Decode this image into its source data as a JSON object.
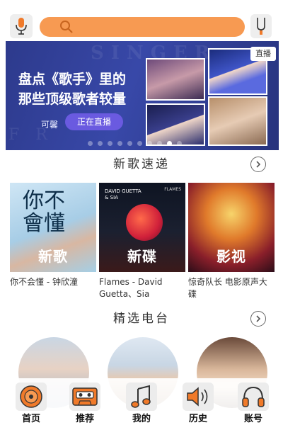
{
  "header": {
    "mic_icon": "microphone-icon",
    "search_icon": "search-icon",
    "tuner_icon": "tuning-fork-icon",
    "search_color": "#f79a52"
  },
  "banner": {
    "headline_line1": "盘点《歌手》里的",
    "headline_line2": "那些顶级歌者较量",
    "host": "可馨",
    "live_button": "正在直播",
    "live_tag": "直播",
    "bg_text": "SINGER",
    "bg_text2": "F R",
    "slide_count": 10,
    "active_slide": 8
  },
  "section_new_songs": {
    "title": "新歌速递",
    "albums": [
      {
        "tag": "新歌",
        "cover_text": "你不\n會懂",
        "caption": "你不会懂 - 钟欣潼"
      },
      {
        "tag": "新碟",
        "cover_brand": "DAVID GUETTA\n& SIA",
        "cover_brand2": "FLAMES",
        "caption": "Flames - David Guetta、Sia"
      },
      {
        "tag": "影视",
        "caption": "惊奇队长 电影原声大碟"
      }
    ]
  },
  "section_radio": {
    "title": "精选电台"
  },
  "bottom_nav": {
    "items": [
      {
        "label": "首页",
        "icon": "record-icon"
      },
      {
        "label": "推荐",
        "icon": "cassette-icon"
      },
      {
        "label": "我的",
        "icon": "music-note-icon"
      },
      {
        "label": "历史",
        "icon": "speaker-icon"
      },
      {
        "label": "账号",
        "icon": "headphones-icon"
      }
    ]
  }
}
